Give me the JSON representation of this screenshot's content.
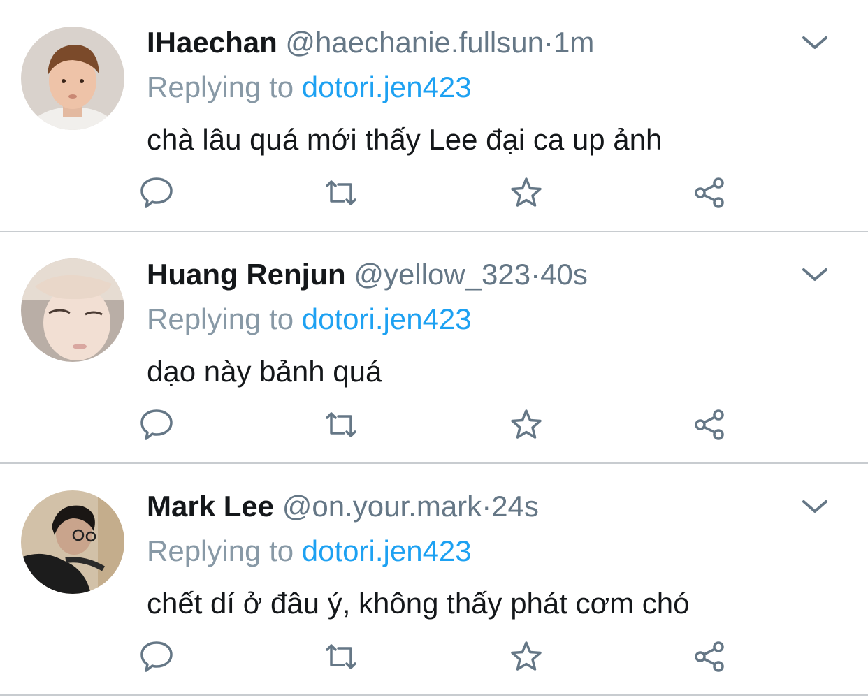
{
  "colors": {
    "name": "#14171a",
    "muted": "#657786",
    "reply_prefix": "#8899a6",
    "link": "#1da1f2",
    "icon": "#657786",
    "divider": "#c8ccd0"
  },
  "icons": {
    "reply": "reply-icon",
    "retweet": "retweet-icon",
    "like": "star-icon",
    "share": "share-icon",
    "more": "chevron-down-icon"
  },
  "tweets": [
    {
      "name": "IHaechan",
      "handle": "@haechanie.fullsun",
      "separator": "·",
      "time": "1m",
      "reply_prefix": "Replying to",
      "reply_to": "dotori.jen423",
      "text": "chà lâu quá mới thấy Lee đại ca up ảnh"
    },
    {
      "name": "Huang Renjun",
      "handle": "@yellow_323",
      "separator": "·",
      "time": "40s",
      "reply_prefix": "Replying to",
      "reply_to": "dotori.jen423",
      "text": "dạo này bảnh quá"
    },
    {
      "name": "Mark Lee",
      "handle": "@on.your.mark",
      "separator": "·",
      "time": "24s",
      "reply_prefix": "Replying to",
      "reply_to": "dotori.jen423",
      "text": "chết dí ở đâu ý, không thấy phát cơm chó"
    }
  ]
}
